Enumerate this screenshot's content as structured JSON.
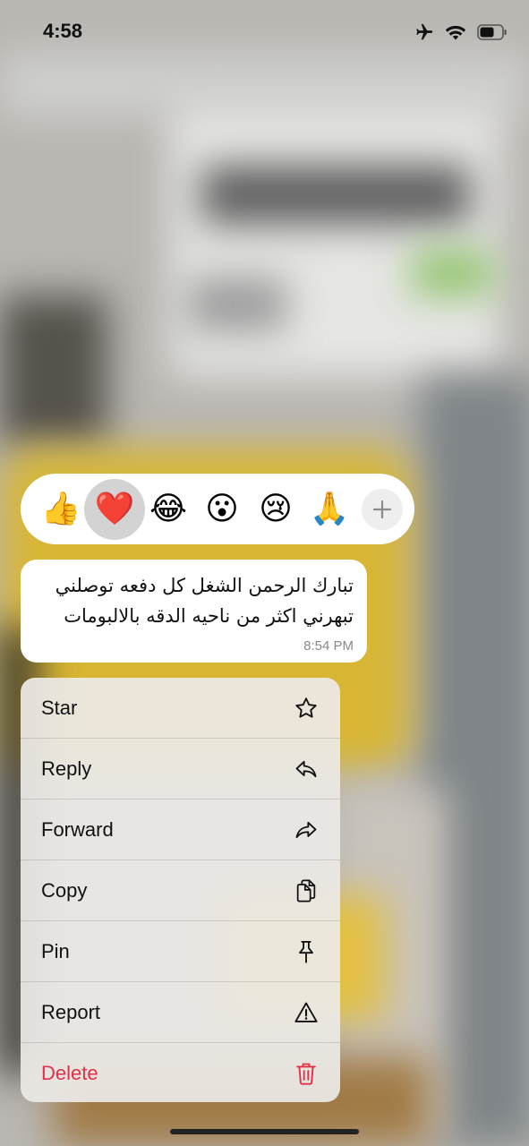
{
  "status_bar": {
    "time": "4:58",
    "icons": [
      "airplane-icon",
      "wifi-icon",
      "battery-icon"
    ]
  },
  "reactions": {
    "items": [
      {
        "emoji": "👍",
        "name": "thumbs-up"
      },
      {
        "emoji": "❤️",
        "name": "heart",
        "selected": true
      },
      {
        "emoji": "😂",
        "name": "laughing"
      },
      {
        "emoji": "😮",
        "name": "surprised"
      },
      {
        "emoji": "😢",
        "name": "crying"
      },
      {
        "emoji": "🙏",
        "name": "praying-hands"
      }
    ],
    "more": "+"
  },
  "message": {
    "text": "تبارك الرحمن الشغل كل دفعه توصلني تبهرني اكثر من ناحيه الدقه بالالبومات",
    "time": "8:54 PM"
  },
  "menu": {
    "items": [
      {
        "label": "Star",
        "icon": "star-icon"
      },
      {
        "label": "Reply",
        "icon": "reply-icon"
      },
      {
        "label": "Forward",
        "icon": "forward-icon"
      },
      {
        "label": "Copy",
        "icon": "copy-icon"
      },
      {
        "label": "Pin",
        "icon": "pin-icon"
      },
      {
        "label": "Report",
        "icon": "warning-icon"
      },
      {
        "label": "Delete",
        "icon": "trash-icon",
        "danger": true
      }
    ]
  },
  "colors": {
    "danger": "#e0304a",
    "bubble": "#ffffff",
    "menu_bg": "#ecebe6"
  }
}
